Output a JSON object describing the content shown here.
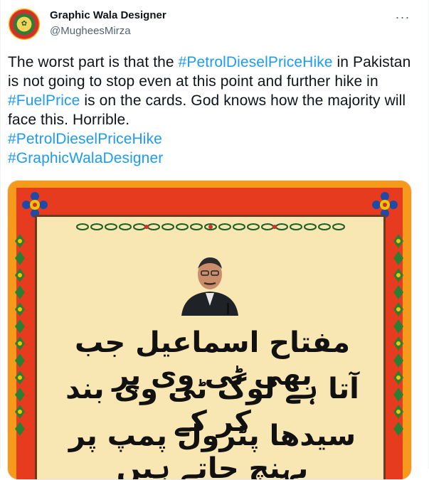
{
  "tweet": {
    "author_name": "Graphic Wala Designer",
    "author_handle": "@MugheesMirza",
    "more_label": "···",
    "text_parts": [
      {
        "text": "The worst part is that the ",
        "type": "plain"
      },
      {
        "text": "#PetrolDieselPriceHike",
        "type": "hashtag"
      },
      {
        "text": " in Pakistan is not going to stop even at this point and further hike in ",
        "type": "plain"
      },
      {
        "text": "#FuelPrice",
        "type": "hashtag"
      },
      {
        "text": " is on the cards. God knows how the majority will face this. Horrible.",
        "type": "plain"
      }
    ],
    "hashtags_after": [
      "#PetrolDieselPriceHike",
      "#GraphicWalaDesigner"
    ]
  },
  "media": {
    "urdu_lines": [
      "مفتاح اسماعیل جب بھی ٹی وی پر",
      "آتا ہے لوگ ٹی وی بند کر کے",
      "سیدھا پٹرول پمپ پر پہنچ جاتے ہیں"
    ],
    "colors": {
      "orange": "#f59a1b",
      "red": "#e73b1f",
      "cream": "#f8e6b3",
      "hashtag": "#1d9bf0"
    },
    "avatar_icon": "urdu-emblem"
  }
}
